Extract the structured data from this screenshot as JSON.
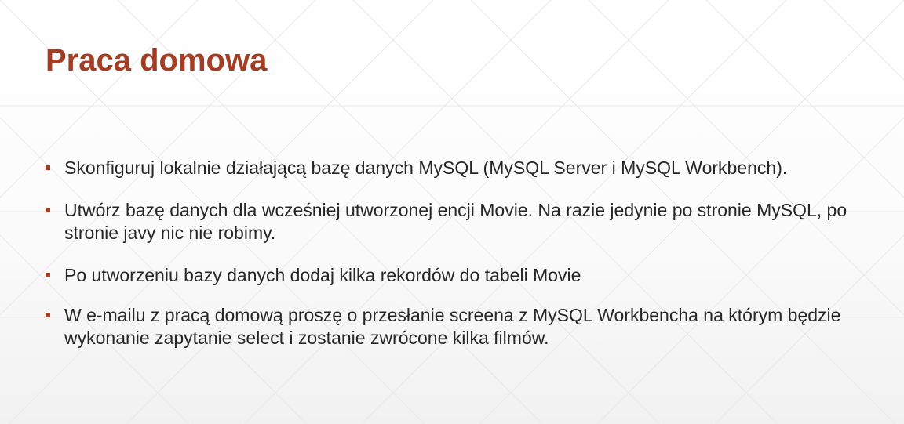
{
  "slide": {
    "title": "Praca domowa",
    "accent_color": "#a33d24",
    "bullets": [
      {
        "text": "Skonfiguruj lokalnie działającą bazę danych MySQL (MySQL Server i MySQL Workbench)."
      },
      {
        "text": "Utwórz bazę danych dla wcześniej utworzonej encji Movie. Na razie jedynie po stronie MySQL, po stronie javy nic nie robimy."
      },
      {
        "text": "Po utworzeniu bazy danych dodaj kilka rekordów do tabeli Movie"
      },
      {
        "text": "W e-mailu z pracą domową proszę o przesłanie screena z MySQL Workbencha na którym będzie wykonanie zapytanie select i zostanie zwrócone kilka filmów."
      }
    ]
  }
}
